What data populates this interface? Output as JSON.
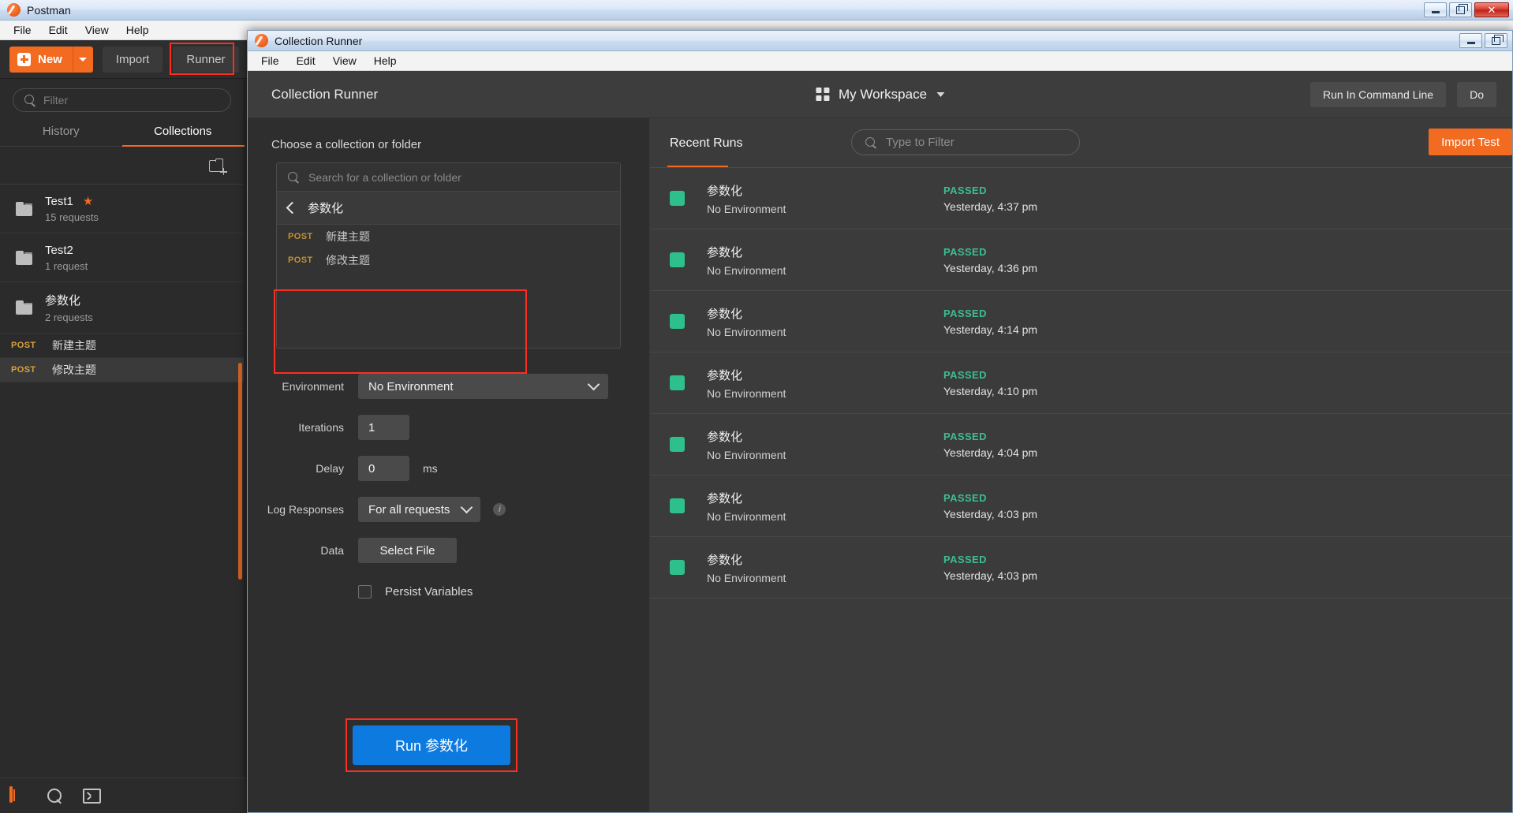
{
  "app": {
    "title": "Postman",
    "logo_icon": "postman-logo-icon",
    "menu": [
      "File",
      "Edit",
      "View",
      "Help"
    ],
    "window_buttons": [
      "minimize-icon",
      "restore-icon",
      "close-icon"
    ]
  },
  "toolbar": {
    "new_label": "New",
    "new_caret_icon": "chevron-down-icon",
    "import_label": "Import",
    "runner_label": "Runner",
    "new_tab_icon": "new-tab-icon",
    "new_tab_caret_icon": "chevron-down-icon"
  },
  "sidebar": {
    "filter_placeholder": "Filter",
    "search_icon": "search-icon",
    "new_folder_icon": "new-folder-icon",
    "tabs": [
      {
        "label": "History",
        "active": false
      },
      {
        "label": "Collections",
        "active": true
      }
    ],
    "collections": [
      {
        "name": "Test1",
        "sub": "15 requests",
        "starred": true,
        "star_icon": "star-icon",
        "folder_icon": "folder-icon"
      },
      {
        "name": "Test2",
        "sub": "1 request",
        "starred": false,
        "folder_icon": "folder-icon"
      },
      {
        "name": "参数化",
        "sub": "2 requests",
        "starred": false,
        "folder_icon": "folder-icon"
      }
    ],
    "requests": [
      {
        "method": "POST",
        "name": "新建主题",
        "selected": false
      },
      {
        "method": "POST",
        "name": "修改主题",
        "selected": true
      }
    ]
  },
  "statusbar": {
    "icons": [
      "sidebar-toggle-icon",
      "search-icon",
      "console-icon"
    ]
  },
  "runner_window": {
    "title": "Collection Runner",
    "logo_icon": "postman-logo-icon",
    "menu": [
      "File",
      "Edit",
      "View",
      "Help"
    ],
    "window_buttons": [
      "minimize-icon",
      "restore-icon"
    ],
    "header": {
      "title": "Collection Runner",
      "workspace_icon": "grid-icon",
      "workspace_label": "My Workspace",
      "workspace_caret_icon": "chevron-down-icon",
      "run_in_cli_label": "Run In Command Line",
      "docs_label": "Do"
    },
    "left_panel": {
      "choose_label": "Choose a collection or folder",
      "search_placeholder": "Search for a collection or folder",
      "search_icon": "search-icon",
      "back_icon": "chevron-left-icon",
      "breadcrumb": "参数化",
      "items": [
        {
          "method": "POST",
          "name": "新建主题"
        },
        {
          "method": "POST",
          "name": "修改主题"
        }
      ],
      "form": {
        "environment_label": "Environment",
        "environment_value": "No Environment",
        "environment_caret_icon": "chevron-down-icon",
        "iterations_label": "Iterations",
        "iterations_value": "1",
        "delay_label": "Delay",
        "delay_value": "0",
        "delay_unit": "ms",
        "log_responses_label": "Log Responses",
        "log_responses_value": "For all requests",
        "log_responses_caret_icon": "chevron-down-icon",
        "log_info_icon": "info-icon",
        "data_label": "Data",
        "data_button": "Select File",
        "persist_checkbox_icon": "checkbox-icon",
        "persist_label": "Persist Variables"
      },
      "run_button": "Run 参数化"
    },
    "right_panel": {
      "tab_label": "Recent Runs",
      "filter_placeholder": "Type to Filter",
      "filter_icon": "search-icon",
      "import_label": "Import Test",
      "runs": [
        {
          "collection": "参数化",
          "environment": "No Environment",
          "status": "PASSED",
          "time": "Yesterday, 4:37 pm",
          "status_icon": "status-square-icon"
        },
        {
          "collection": "参数化",
          "environment": "No Environment",
          "status": "PASSED",
          "time": "Yesterday, 4:36 pm",
          "status_icon": "status-square-icon"
        },
        {
          "collection": "参数化",
          "environment": "No Environment",
          "status": "PASSED",
          "time": "Yesterday, 4:14 pm",
          "status_icon": "status-square-icon"
        },
        {
          "collection": "参数化",
          "environment": "No Environment",
          "status": "PASSED",
          "time": "Yesterday, 4:10 pm",
          "status_icon": "status-square-icon"
        },
        {
          "collection": "参数化",
          "environment": "No Environment",
          "status": "PASSED",
          "time": "Yesterday, 4:04 pm",
          "status_icon": "status-square-icon"
        },
        {
          "collection": "参数化",
          "environment": "No Environment",
          "status": "PASSED",
          "time": "Yesterday, 4:03 pm",
          "status_icon": "status-square-icon"
        },
        {
          "collection": "参数化",
          "environment": "No Environment",
          "status": "PASSED",
          "time": "Yesterday, 4:03 pm",
          "status_icon": "status-square-icon"
        }
      ]
    }
  },
  "colors": {
    "accent_orange": "#f26b21",
    "highlight_red": "#fe2d23",
    "run_blue": "#0d7ae0",
    "pass_green": "#3dbd8f",
    "method_amber": "#d9a23a"
  }
}
